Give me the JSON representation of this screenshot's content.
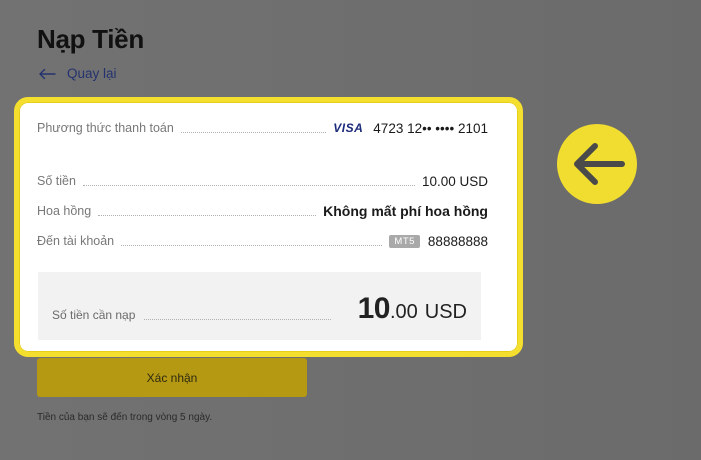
{
  "page": {
    "title": "Nạp Tiền",
    "back_label": "Quay lại"
  },
  "details": {
    "payment_method": {
      "label": "Phương thức thanh toán",
      "card_brand": "VISA",
      "card_number": "4723 12•• •••• 2101"
    },
    "amount": {
      "label": "Số tiền",
      "value": "10.00 USD"
    },
    "commission": {
      "label": "Hoa hồng",
      "value": "Không mất phí hoa hồng"
    },
    "to_account": {
      "label": "Đến tài khoản",
      "platform_badge": "MT5",
      "account_number": "88888888"
    }
  },
  "total": {
    "label": "Số tiền cần nạp",
    "amount_integer": "10",
    "amount_decimal": ".00",
    "currency": "USD"
  },
  "confirm_label": "Xác nhận",
  "note": "Tiền của bạn sẽ đến trong vòng 5 ngày.",
  "colors": {
    "highlight": "#f5df2e",
    "confirm_button": "#b59912",
    "link": "#24336e",
    "overlay_background": "#6f6f6f"
  },
  "icons": {
    "back": "arrow-left-icon",
    "callout": "arrow-left-icon"
  }
}
